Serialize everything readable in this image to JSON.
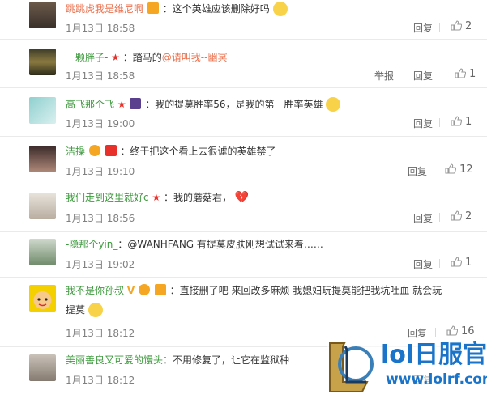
{
  "comments": [
    {
      "user": "跳跳虎我是维尼啊",
      "sep": "：",
      "text": "这个英雄应该删除好吗",
      "date": "1月13日 18:58",
      "reply": "回复",
      "likes": "2",
      "has_report": false
    },
    {
      "user": "一颗胖子-",
      "sep": "：",
      "text_pre": "踏马的",
      "mention": "@请叫我--幽冥",
      "date": "1月13日 18:58",
      "report": "举报",
      "reply": "回复",
      "likes": "1",
      "has_report": true
    },
    {
      "user": "高飞那个飞",
      "sep": "：",
      "text": "我的提莫胜率56，是我的第一胜率英雄",
      "date": "1月13日 19:00",
      "reply": "回复",
      "likes": "1"
    },
    {
      "user": "洁操",
      "sep": "：",
      "text": "终于把这个看上去很谑的英雄禁了",
      "date": "1月13日 19:10",
      "reply": "回复",
      "likes": "12"
    },
    {
      "user": "我们走到这里就好c",
      "sep": "：",
      "text": "我的蘑菇君，",
      "date": "1月13日 18:56",
      "reply": "回复",
      "likes": "2"
    },
    {
      "user": "-隐那个yin_",
      "sep": "：",
      "text": "@WANHFANG 有提莫皮肤刚想试试来着……",
      "date": "1月13日 19:02",
      "reply": "回复",
      "likes": "1"
    },
    {
      "user": "我不是你孙叔",
      "sep": "：",
      "text": "直接删了吧 来回改多麻烦 我媳妇玩提莫能把我坑吐血 就会玩",
      "text2": "提莫",
      "date": "1月13日 18:12",
      "reply": "回复",
      "likes": "16"
    },
    {
      "user": "美丽善良又可爱的馒头",
      "sep": "：",
      "text": "不用修复了，让它在监狱种",
      "date": "1月13日 18:12",
      "reply": "回复"
    }
  ],
  "watermark": {
    "brand": "lol日服官网",
    "url": "www.lolrf.com"
  },
  "colors": {
    "username": "#eb7350",
    "green_user": "#3e9a3e",
    "date": "#808080"
  }
}
